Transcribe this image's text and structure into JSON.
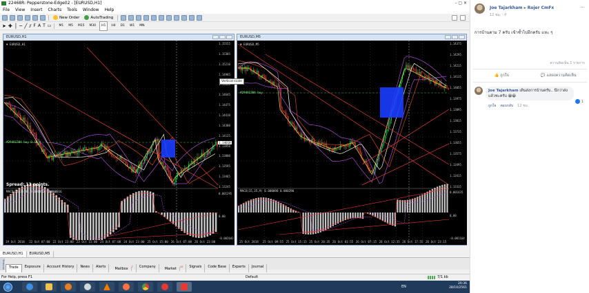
{
  "window": {
    "title": "22468R: Pepperstone-Edge02 - [EURUSD,H1]"
  },
  "menu": [
    "File",
    "View",
    "Insert",
    "Charts",
    "Tools",
    "Window",
    "Help"
  ],
  "toolbar": {
    "new_order": "New Order",
    "autotrading": "AutoTrading",
    "timeframes": [
      "M1",
      "M5",
      "M15",
      "M30",
      "H1",
      "H4",
      "D1",
      "W1",
      "MN"
    ]
  },
  "chart_left": {
    "title": "EURUSD,H1",
    "info": "▼ EURUSD,H1",
    "order_label": "#29481384 buy 0.10",
    "spread": "Spread: 13 points.",
    "macd_label": "MACD(15,35,9) 0.000052 -0.000816",
    "price_ticks": [
      "1.15555",
      "1.15385",
      "1.15210",
      "1.14985",
      "1.14820",
      "1.14645",
      "1.14475",
      "1.14410",
      "1.14300",
      "1.14125",
      "1.13950",
      "1.13800",
      "1.13595",
      "1.13465",
      "1.13245"
    ],
    "macd_ticks": [
      "0.001295",
      "0.00",
      "-0.002642"
    ],
    "time_ticks": [
      "19 Oct 2018",
      "22 Oct 07:00",
      "22 Oct 23:00",
      "23 Oct 15:00",
      "24 Oct 07:00",
      "24 Oct 23:00",
      "25 Oct 15:00",
      "26 Oct 07:00",
      "26 Oct 23:00"
    ],
    "current_price": "1.14018"
  },
  "chart_right": {
    "title": "EURUSD,M5",
    "info": "▼ EURUSD,M5",
    "order_label": "#29481384 buy",
    "macd_label": "MACD(15,35,9) 0.000090 0.000290",
    "price_ticks": [
      "1.14375",
      "1.14295",
      "1.14215",
      "1.14135",
      "1.14055",
      "1.13975",
      "1.13895",
      "1.13815",
      "1.13735",
      "1.13655",
      "1.13575",
      "1.13495",
      "1.13415",
      "1.13335"
    ],
    "macd_ticks": [
      "0.001435",
      "0.00",
      "-0.001164"
    ],
    "time_ticks": [
      "25 Oct 2018",
      "25 Oct 09:55",
      "25 Oct 15:15",
      "25 Oct 20:35",
      "26 Oct 01:55",
      "26 Oct 07:15",
      "26 Oct 12:35",
      "26 Oct 17:55",
      "26 Oct 23:15"
    ]
  },
  "tooltip": "Vertical scale",
  "chart_tabs": [
    "EURUSD,H1",
    "EURUSD,M5"
  ],
  "terminal": {
    "side_label": "Terminal",
    "tabs": [
      "Trade",
      "Exposure",
      "Account History",
      "News",
      "Alerts",
      "Mailbox",
      "Company",
      "Market",
      "Signals",
      "Code Base",
      "Experts",
      "Journal"
    ],
    "badges": {
      "Mailbox": "7",
      "Market": "10"
    }
  },
  "status": {
    "left": "For Help, press F1",
    "middle": "Default",
    "right": "7/1 kb"
  },
  "taskbar": {
    "lang": "EN",
    "time": "20:36",
    "date": "28/10/2561"
  },
  "facebook": {
    "post_author": "Joe Tajarkham",
    "post_arrow": "▸",
    "post_target": "Rojer CmFx",
    "post_time": "12 ชม.",
    "post_text": "การบ้านตาม 7 ครับ เข้าซ้ำไปอีกครับ แหะ ๆ",
    "seen": "ความคิดเห็น 1 รายการ",
    "like_label": "ถูกใจ",
    "comment_label": "แสดงความคิดเห็น",
    "comment_author": "Joe Tajarkham",
    "comment_text": "เดินส่งการบ้านครับ.. นึกว่าส่งแล้วซะครับ 😁😁",
    "comment_like": "ถูกใจ",
    "comment_reply": "ตอบกลับ",
    "comment_time": "12 ชม.",
    "comment_likes": "1"
  },
  "colors": {
    "chart_bg": "#000000",
    "bull": "#00c853",
    "bear": "#e53935",
    "box": "#1a3cff"
  }
}
